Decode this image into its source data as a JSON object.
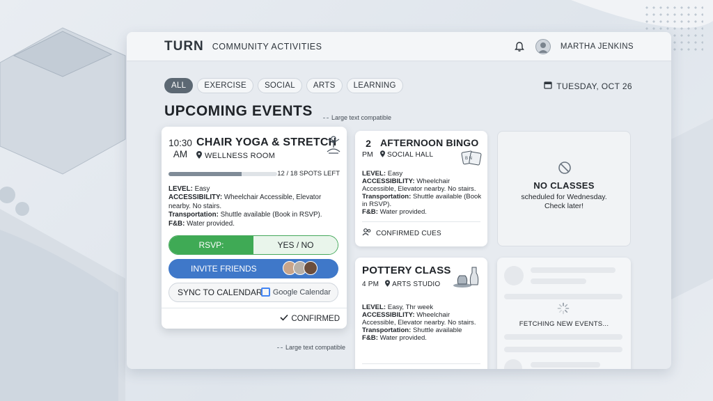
{
  "header": {
    "brand": "TURN",
    "subtitle": "COMMUNITY ACTIVITIES",
    "user_name": "MARTHA JENKINS"
  },
  "filters": [
    "ALL",
    "EXERCISE",
    "SOCIAL",
    "ARTS",
    "LEARNING"
  ],
  "active_filter": "ALL",
  "date": "TUESDAY, OCT 26",
  "page_title": "UPCOMING EVENTS",
  "notes": {
    "top": "Large text compatible",
    "bottom": "Large text compatible"
  },
  "featured": {
    "time": "10:30",
    "ampm": "AM",
    "title": "CHAIR YOGA & STRETCH",
    "location": "WELLNESS ROOM",
    "spots": "12 / 18 SPOTS LEFT",
    "progress": 0.67,
    "level_label": "LEVEL:",
    "level": "Easy",
    "access_label": "ACCESSIBILITY:",
    "access": "Wheelchair Accessible, Elevator nearby. No stairs.",
    "transport_label": "Transportation:",
    "transport": "Shuttle available (Book in RSVP).",
    "fnb_label": "F&B:",
    "fnb": "Water provided.",
    "rsvp_label": "RSVP:",
    "rsvp_options": "YES / NO",
    "invite_label": "INVITE FRIENDS",
    "sync_label": "SYNC TO CALENDAR",
    "gcal_label": "Google Calendar",
    "status": "CONFIRMED"
  },
  "bingo": {
    "time": "2",
    "ampm": "PM",
    "title": "AFTERNOON BINGO",
    "location": "SOCIAL HALL",
    "level_label": "LEVEL:",
    "level": "Easy",
    "access_label": "ACCESSIBILITY:",
    "access": "Wheelchair Accessible, Elevator nearby. No stairs.",
    "transport_label": "Transportation:",
    "transport": "Shuttle available (Book in RSVP).",
    "fnb_label": "F&B:",
    "fnb": "Water provided.",
    "footer": "CONFIRMED CUES"
  },
  "no_classes": {
    "title": "NO CLASSES",
    "subtitle": "scheduled for Wednesday. Check later!"
  },
  "pottery": {
    "title": "POTTERY CLASS",
    "time": "4 PM",
    "location": "ARTS STUDIO",
    "level_label": "LEVEL:",
    "level": "Easy, Thr week",
    "access_label": "ACCESSIBILITY:",
    "access": "Wheelchair Accessible, Elevator nearby. No stairs.",
    "transport_label": "Transportation:",
    "transport": "Shuttle available",
    "fnb_label": "F&B:",
    "fnb": "Water provided."
  },
  "fetching": {
    "label": "FETCHING NEW EVENTS..."
  },
  "colors": {
    "rsvp_green": "#3faa55",
    "invite_blue": "#3f78c9",
    "active_chip": "#5c6873"
  }
}
